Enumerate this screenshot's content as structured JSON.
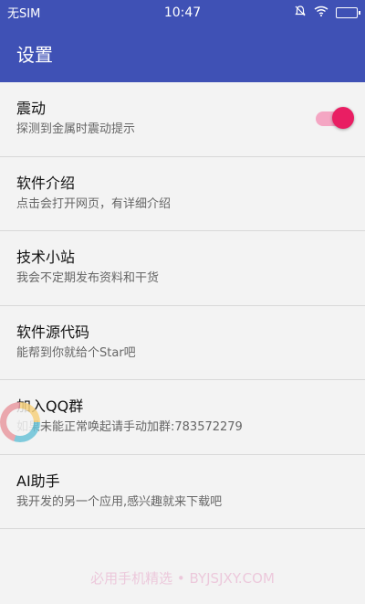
{
  "status_bar": {
    "carrier": "无SIM",
    "time": "10:47",
    "icons": [
      "alarm-icon",
      "wifi-icon",
      "battery-icon"
    ]
  },
  "app_bar": {
    "title": "设置"
  },
  "settings": [
    {
      "title": "震动",
      "subtitle": "探测到金属时震动提示",
      "toggle": true
    },
    {
      "title": "软件介绍",
      "subtitle": "点击会打开网页，有详细介绍"
    },
    {
      "title": "技术小站",
      "subtitle": "我会不定期发布资料和干货"
    },
    {
      "title": "软件源代码",
      "subtitle": "能帮到你就给个Star吧"
    },
    {
      "title": "加入QQ群",
      "subtitle": "如果未能正常唤起请手动加群:783572279"
    },
    {
      "title": "AI助手",
      "subtitle": "我开发的另一个应用,感兴趣就来下载吧"
    }
  ],
  "watermark": "必用手机精选 • BYJSJXY.COM",
  "colors": {
    "primary": "#3f51b5",
    "accent": "#e91e63"
  }
}
